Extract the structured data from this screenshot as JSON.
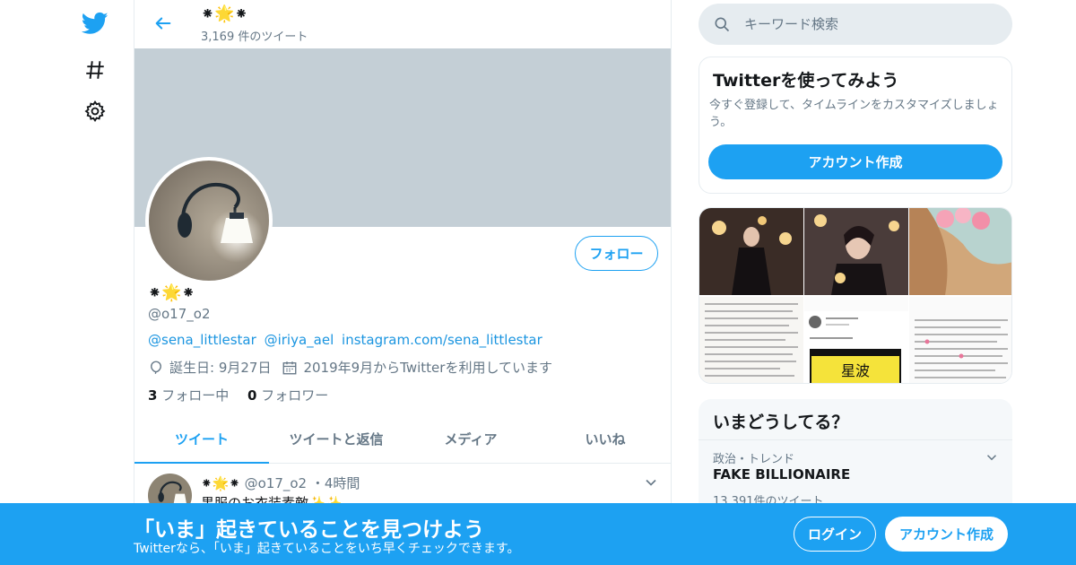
{
  "colors": {
    "accent": "#1da1f2",
    "text": "#14171a",
    "secondary": "#657786",
    "banner": "#c4cfd6",
    "border": "#e6ecf0"
  },
  "nav": {
    "icons": [
      "twitter-bird-icon",
      "hashtag-icon",
      "gear-icon"
    ]
  },
  "header": {
    "name": "⁕🌟⁕",
    "tweet_count": "3,169 件のツイート"
  },
  "profile": {
    "name": "⁕🌟⁕",
    "handle": "@o17_o2",
    "bio_links": [
      "@sena_littlestar",
      "@iriya_ael",
      "instagram.com/sena_littlestar"
    ],
    "birthday": "誕生日: 9月27日",
    "joined": "2019年9月からTwitterを利用しています",
    "following_count": "3",
    "following_label": "フォロー中",
    "followers_count": "0",
    "followers_label": "フォロワー",
    "follow_button": "フォロー"
  },
  "tabs": [
    {
      "label": "ツイート",
      "active": true
    },
    {
      "label": "ツイートと返信",
      "active": false
    },
    {
      "label": "メディア",
      "active": false
    },
    {
      "label": "いいね",
      "active": false
    }
  ],
  "tweet": {
    "name": "⁕🌟⁕",
    "handle": "@o17_o2",
    "time": "・4時間",
    "text": "黒服のお衣装素敵✨✨"
  },
  "search": {
    "placeholder": "キーワード検索"
  },
  "signup_card": {
    "title": "Twitterを使ってみよう",
    "description": "今すぐ登録して、タイムラインをカスタマイズしましょう。",
    "button": "アカウント作成"
  },
  "media": {
    "tile_text": "星波"
  },
  "trends": {
    "title": "いまどうしてる？",
    "items": [
      {
        "category": "政治・トレンド",
        "name": "FAKE BILLIONAIRE",
        "count": "13,391件のツイート"
      }
    ]
  },
  "bottom_bar": {
    "title": "「いま」起きていることを見つけよう",
    "subtitle": "Twitterなら、「いま」起きていることをいち早くチェックできます。",
    "login": "ログイン",
    "signup": "アカウント作成"
  }
}
